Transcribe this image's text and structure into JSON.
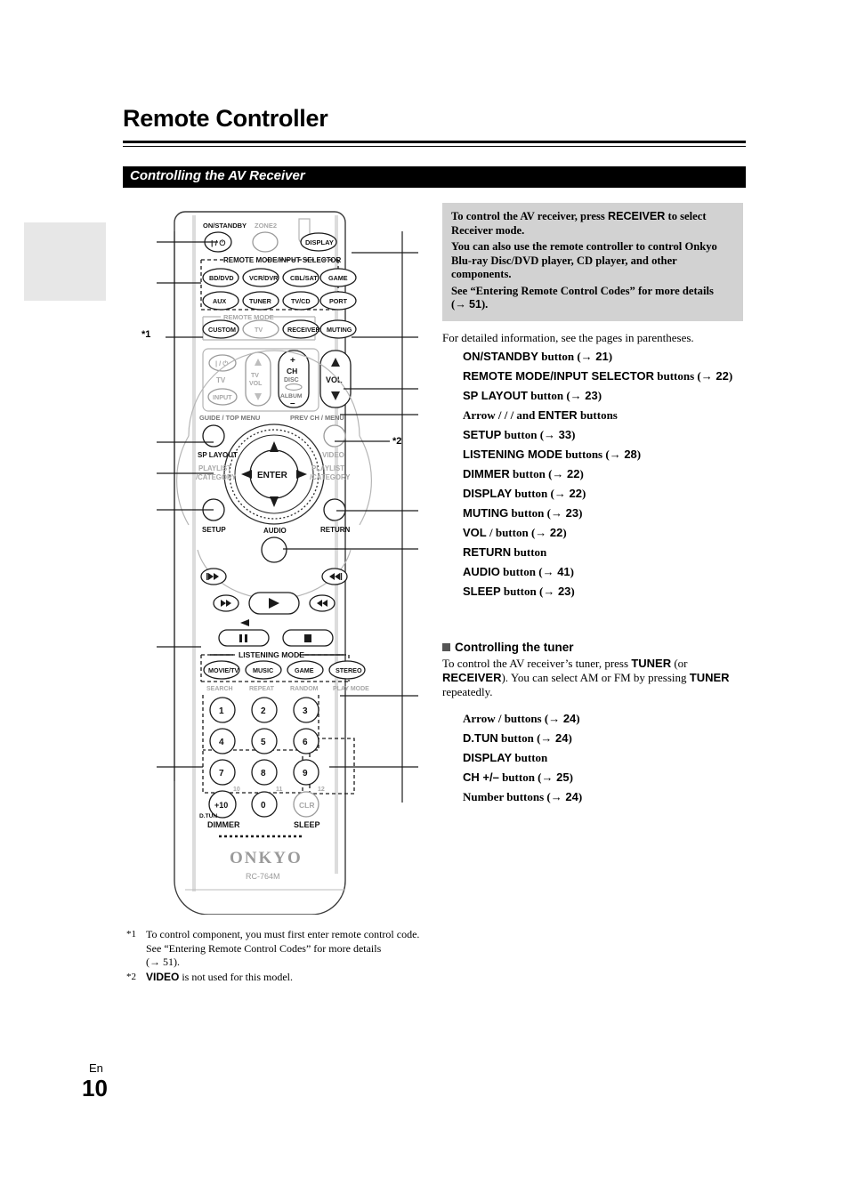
{
  "page": {
    "title": "Remote Controller",
    "section_heading": "Controlling the AV Receiver",
    "language_code": "En",
    "page_number": "10"
  },
  "info_box": {
    "p1_a": "To control the AV receiver, press ",
    "p1_b": "RECEIVER",
    "p1_c": " to select Receiver mode.",
    "p2": "You can also use the remote controller to control Onkyo Blu-ray Disc/DVD player, CD player, and other components.",
    "p3_a": "See “Entering Remote Control Codes” for more details (",
    "p3_arrow": "→",
    "p3_page": "51",
    "p3_b": ")."
  },
  "detail_intro": "For detailed information, see the pages in parentheses.",
  "receiver_refs": [
    {
      "name": "ON/STANDBY",
      "tail": " button (",
      "arrow": "→",
      "page": "21",
      "close": ")"
    },
    {
      "name": "REMOTE MODE/INPUT SELECTOR",
      "tail": " buttons (",
      "arrow": "→",
      "page": "22",
      "close": ")"
    },
    {
      "name": "SP LAYOUT",
      "tail": " button (",
      "arrow": "→",
      "page": "23",
      "close": ")"
    },
    {
      "name": "Arrow",
      "serif_name": true,
      "tail": "  /  /  /   and ",
      "name2": "ENTER",
      "tail2": " buttons",
      "arrow": "",
      "page": "",
      "close": ""
    },
    {
      "name": "SETUP",
      "tail": " button (",
      "arrow": "→",
      "page": "33",
      "close": ")"
    },
    {
      "name": "LISTENING MODE",
      "tail": " buttons (",
      "arrow": "→",
      "page": "28",
      "close": ")"
    },
    {
      "name": "DIMMER",
      "tail": " button (",
      "arrow": "→",
      "page": "22",
      "close": ")"
    },
    {
      "name": "DISPLAY",
      "tail": " button (",
      "arrow": "→",
      "page": "22",
      "close": ")"
    },
    {
      "name": "MUTING",
      "tail": " button (",
      "arrow": "→",
      "page": "23",
      "close": ")"
    },
    {
      "name": "VOL",
      "tail": "   /    button (",
      "arrow": "→",
      "page": "22",
      "close": ")"
    },
    {
      "name": "RETURN",
      "tail": " button",
      "arrow": "",
      "page": "",
      "close": ""
    },
    {
      "name": "AUDIO",
      "tail": " button (",
      "arrow": "→",
      "page": "41",
      "close": ")"
    },
    {
      "name": "SLEEP",
      "tail": " button (",
      "arrow": "→",
      "page": "23",
      "close": ")"
    }
  ],
  "tuner": {
    "heading": "Controlling the tuner",
    "para_a": "To control the AV receiver’s tuner, press ",
    "para_b": "TUNER",
    "para_c": " (or ",
    "para_d": "RECEIVER",
    "para_e": ").",
    "para_f": "You can select AM or FM by pressing ",
    "para_g": "TUNER",
    "para_h": " repeatedly.",
    "refs": [
      {
        "name": "Arrow",
        "serif_name": true,
        "tail": "   /   buttons (",
        "arrow": "→",
        "page": "24",
        "close": ")"
      },
      {
        "name": "D.TUN",
        "tail": " button (",
        "arrow": "→",
        "page": "24",
        "close": ")"
      },
      {
        "name": "DISPLAY",
        "tail": " button",
        "arrow": "",
        "page": "",
        "close": ""
      },
      {
        "name": "CH +/–",
        "tail": " button (",
        "arrow": "→",
        "page": "25",
        "close": ")"
      },
      {
        "name": "Number",
        "serif_name": true,
        "tail": " buttons (",
        "arrow": "→",
        "page": "24",
        "close": ")"
      }
    ]
  },
  "footnotes": [
    {
      "mark": "*1",
      "lines": [
        "To control component, you must first enter remote control code.",
        "See “Entering Remote Control Codes” for more details",
        "(→ 51)."
      ]
    },
    {
      "mark": "*2",
      "bold_lead": "VIDEO",
      "lines": [
        " is not used for this model."
      ]
    }
  ],
  "callout_markers": {
    "star1": "*1",
    "star2": "*2"
  },
  "remote": {
    "brand": "ONKYO",
    "model": "RC-764M",
    "labels": {
      "on_standby": "ON/STANDBY",
      "zone2": "ZONE2",
      "display": "DISPLAY",
      "remote_mode_input_selector": "REMOTE MODE/INPUT SELECTOR",
      "remote_mode": "REMOTE MODE",
      "muting": "MUTING",
      "tv": "TV",
      "tv_vol": "TV\nVOL",
      "input": "INPUT",
      "ch": "CH",
      "disc": "DISC",
      "album": "ALBUM",
      "vol": "VOL",
      "guide_top_menu": "GUIDE / TOP MENU",
      "prev_ch_menu": "PREV CH / MENU",
      "sp_layout": "SP LAYOUT",
      "video": "VIDEO",
      "playlist_left": "PLAYLIST",
      "category_left": "/CATEGORY",
      "playlist_right": "PLAYLIST",
      "category_right": "/CATEGORY",
      "enter": "ENTER",
      "setup": "SETUP",
      "return": "RETURN",
      "audio": "AUDIO",
      "listening_mode": "LISTENING MODE",
      "search": "SEARCH",
      "repeat": "REPEAT",
      "random": "RANDOM",
      "play_mode": "PLAY MODE",
      "d_tun": "D.TUN",
      "dimmer": "DIMMER",
      "sleep": "SLEEP",
      "clr": "CLR"
    },
    "input_selector_buttons": [
      "BD/DVD",
      "VCR/DVR",
      "CBL/SAT",
      "GAME",
      "AUX",
      "TUNER",
      "TV/CD",
      "PORT"
    ],
    "remote_mode_buttons": [
      "CUSTOM",
      "TV",
      "RECEIVER"
    ],
    "listening_mode_buttons": [
      "MOVIE/TV",
      "MUSIC",
      "GAME",
      "STEREO"
    ],
    "number_buttons": [
      "1",
      "2",
      "3",
      "4",
      "5",
      "6",
      "7",
      "8",
      "9",
      "+10",
      "0",
      "CLR"
    ],
    "number_super": [
      "10",
      "11",
      "12"
    ]
  }
}
